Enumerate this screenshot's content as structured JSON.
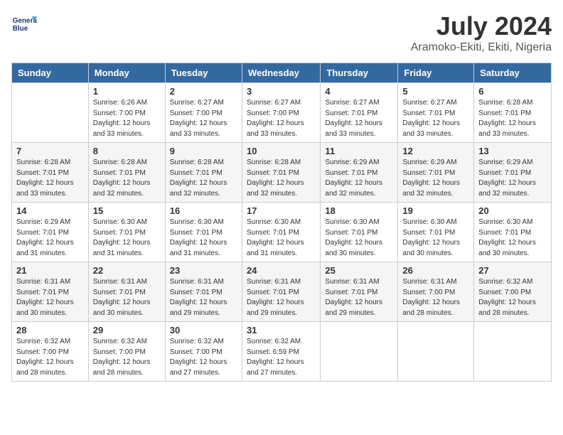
{
  "logo": {
    "line1": "General",
    "line2": "Blue"
  },
  "title": "July 2024",
  "location": "Aramoko-Ekiti, Ekiti, Nigeria",
  "days_of_week": [
    "Sunday",
    "Monday",
    "Tuesday",
    "Wednesday",
    "Thursday",
    "Friday",
    "Saturday"
  ],
  "weeks": [
    [
      {
        "day": "",
        "info": ""
      },
      {
        "day": "1",
        "info": "Sunrise: 6:26 AM\nSunset: 7:00 PM\nDaylight: 12 hours\nand 33 minutes."
      },
      {
        "day": "2",
        "info": "Sunrise: 6:27 AM\nSunset: 7:00 PM\nDaylight: 12 hours\nand 33 minutes."
      },
      {
        "day": "3",
        "info": "Sunrise: 6:27 AM\nSunset: 7:00 PM\nDaylight: 12 hours\nand 33 minutes."
      },
      {
        "day": "4",
        "info": "Sunrise: 6:27 AM\nSunset: 7:01 PM\nDaylight: 12 hours\nand 33 minutes."
      },
      {
        "day": "5",
        "info": "Sunrise: 6:27 AM\nSunset: 7:01 PM\nDaylight: 12 hours\nand 33 minutes."
      },
      {
        "day": "6",
        "info": "Sunrise: 6:28 AM\nSunset: 7:01 PM\nDaylight: 12 hours\nand 33 minutes."
      }
    ],
    [
      {
        "day": "7",
        "info": "Sunrise: 6:28 AM\nSunset: 7:01 PM\nDaylight: 12 hours\nand 33 minutes."
      },
      {
        "day": "8",
        "info": "Sunrise: 6:28 AM\nSunset: 7:01 PM\nDaylight: 12 hours\nand 32 minutes."
      },
      {
        "day": "9",
        "info": "Sunrise: 6:28 AM\nSunset: 7:01 PM\nDaylight: 12 hours\nand 32 minutes."
      },
      {
        "day": "10",
        "info": "Sunrise: 6:28 AM\nSunset: 7:01 PM\nDaylight: 12 hours\nand 32 minutes."
      },
      {
        "day": "11",
        "info": "Sunrise: 6:29 AM\nSunset: 7:01 PM\nDaylight: 12 hours\nand 32 minutes."
      },
      {
        "day": "12",
        "info": "Sunrise: 6:29 AM\nSunset: 7:01 PM\nDaylight: 12 hours\nand 32 minutes."
      },
      {
        "day": "13",
        "info": "Sunrise: 6:29 AM\nSunset: 7:01 PM\nDaylight: 12 hours\nand 32 minutes."
      }
    ],
    [
      {
        "day": "14",
        "info": "Sunrise: 6:29 AM\nSunset: 7:01 PM\nDaylight: 12 hours\nand 31 minutes."
      },
      {
        "day": "15",
        "info": "Sunrise: 6:30 AM\nSunset: 7:01 PM\nDaylight: 12 hours\nand 31 minutes."
      },
      {
        "day": "16",
        "info": "Sunrise: 6:30 AM\nSunset: 7:01 PM\nDaylight: 12 hours\nand 31 minutes."
      },
      {
        "day": "17",
        "info": "Sunrise: 6:30 AM\nSunset: 7:01 PM\nDaylight: 12 hours\nand 31 minutes."
      },
      {
        "day": "18",
        "info": "Sunrise: 6:30 AM\nSunset: 7:01 PM\nDaylight: 12 hours\nand 30 minutes."
      },
      {
        "day": "19",
        "info": "Sunrise: 6:30 AM\nSunset: 7:01 PM\nDaylight: 12 hours\nand 30 minutes."
      },
      {
        "day": "20",
        "info": "Sunrise: 6:30 AM\nSunset: 7:01 PM\nDaylight: 12 hours\nand 30 minutes."
      }
    ],
    [
      {
        "day": "21",
        "info": "Sunrise: 6:31 AM\nSunset: 7:01 PM\nDaylight: 12 hours\nand 30 minutes."
      },
      {
        "day": "22",
        "info": "Sunrise: 6:31 AM\nSunset: 7:01 PM\nDaylight: 12 hours\nand 30 minutes."
      },
      {
        "day": "23",
        "info": "Sunrise: 6:31 AM\nSunset: 7:01 PM\nDaylight: 12 hours\nand 29 minutes."
      },
      {
        "day": "24",
        "info": "Sunrise: 6:31 AM\nSunset: 7:01 PM\nDaylight: 12 hours\nand 29 minutes."
      },
      {
        "day": "25",
        "info": "Sunrise: 6:31 AM\nSunset: 7:01 PM\nDaylight: 12 hours\nand 29 minutes."
      },
      {
        "day": "26",
        "info": "Sunrise: 6:31 AM\nSunset: 7:00 PM\nDaylight: 12 hours\nand 28 minutes."
      },
      {
        "day": "27",
        "info": "Sunrise: 6:32 AM\nSunset: 7:00 PM\nDaylight: 12 hours\nand 28 minutes."
      }
    ],
    [
      {
        "day": "28",
        "info": "Sunrise: 6:32 AM\nSunset: 7:00 PM\nDaylight: 12 hours\nand 28 minutes."
      },
      {
        "day": "29",
        "info": "Sunrise: 6:32 AM\nSunset: 7:00 PM\nDaylight: 12 hours\nand 28 minutes."
      },
      {
        "day": "30",
        "info": "Sunrise: 6:32 AM\nSunset: 7:00 PM\nDaylight: 12 hours\nand 27 minutes."
      },
      {
        "day": "31",
        "info": "Sunrise: 6:32 AM\nSunset: 6:59 PM\nDaylight: 12 hours\nand 27 minutes."
      },
      {
        "day": "",
        "info": ""
      },
      {
        "day": "",
        "info": ""
      },
      {
        "day": "",
        "info": ""
      }
    ]
  ]
}
